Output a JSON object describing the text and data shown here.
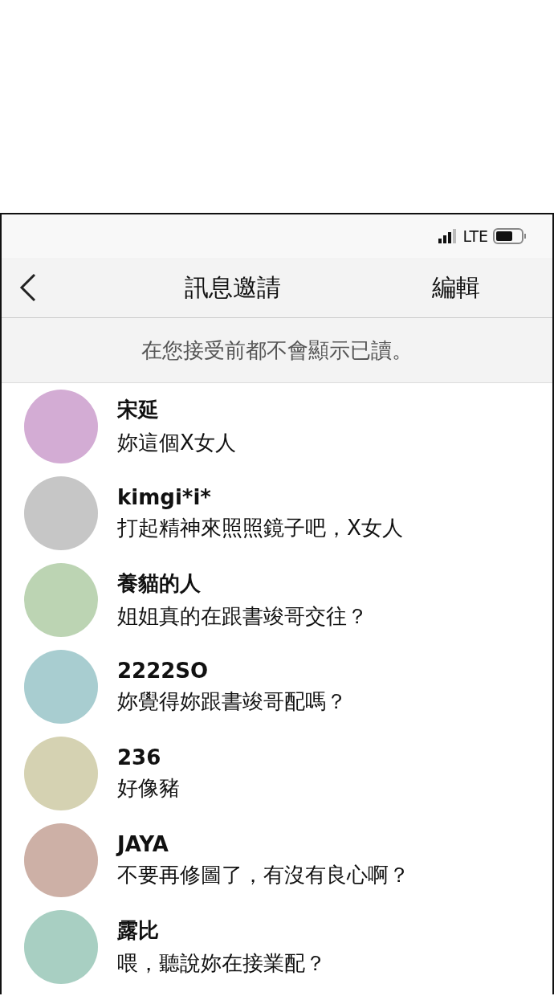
{
  "status_bar": {
    "network": "LTE"
  },
  "header": {
    "title": "訊息邀請",
    "edit": "編輯"
  },
  "notice": "在您接受前都不會顯示已讀。",
  "requests": [
    {
      "name": "宋延",
      "message": "妳這個X女人",
      "color": "#d3acd4"
    },
    {
      "name": "kimgi*i*",
      "message": "打起精神來照照鏡子吧，X女人",
      "color": "#c6c6c6"
    },
    {
      "name": "養貓的人",
      "message": "姐姐真的在跟書竣哥交往？",
      "color": "#bcd4b3"
    },
    {
      "name": "2222SO",
      "message": "妳覺得妳跟書竣哥配嗎？",
      "color": "#a8cdd0"
    },
    {
      "name": "236",
      "message": "好像豬",
      "color": "#d5d2b2"
    },
    {
      "name": "JAYA",
      "message": "不要再修圖了，有沒有良心啊？",
      "color": "#cdb0a6"
    },
    {
      "name": "露比",
      "message": "喂，聽說妳在接業配？",
      "color": "#a8cfc2"
    }
  ]
}
